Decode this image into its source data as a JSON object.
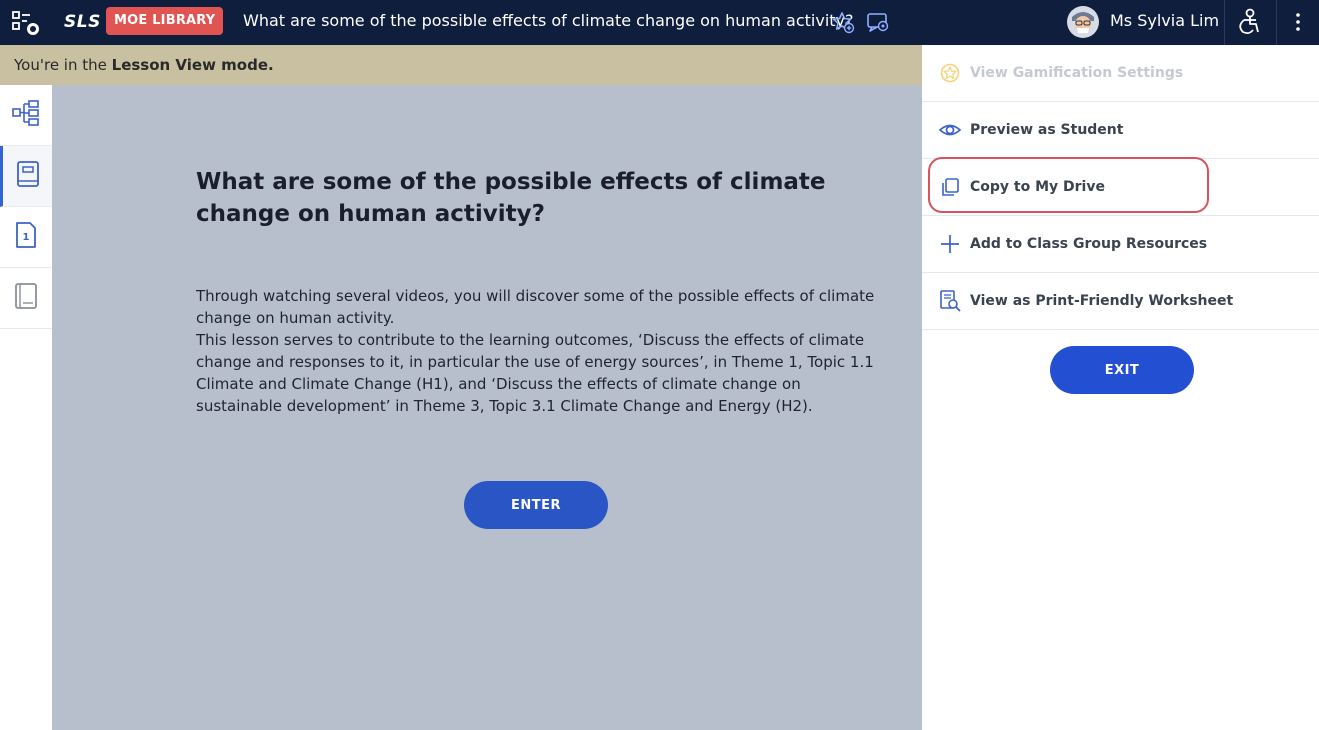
{
  "topbar": {
    "logo": "SLS",
    "badge": "MOE LIBRARY",
    "title": "What are some of the possible effects of climate change on human activity?",
    "user_name": "Ms Sylvia Lim",
    "icons": [
      "apps-icon",
      "add-favourite-icon",
      "monitor-icon",
      "avatar",
      "accessibility-icon",
      "more-vert-icon"
    ]
  },
  "banner": {
    "prefix": "You're in the ",
    "mode": "Lesson View mode."
  },
  "sidebar": {
    "items": [
      {
        "icon": "lesson-map-icon",
        "active": false
      },
      {
        "icon": "book-icon",
        "active": true
      },
      {
        "icon": "page-number-icon",
        "number": "1",
        "active": false
      },
      {
        "icon": "notebook-icon",
        "active": false
      }
    ]
  },
  "main": {
    "title": "What are some of the possible effects of climate change on human activity?",
    "paragraph1": "Through watching several videos, you will discover some of the possible effects of climate change on human activity.",
    "paragraph2": "This lesson serves to contribute to the learning outcomes, ‘Discuss the effects of climate change and responses to it, in particular the use of energy sources’, in Theme 1, Topic 1.1 Climate and Climate Change (H1), and ‘Discuss the effects of climate change on sustainable development’ in Theme 3, Topic 3.1 Climate Change and Energy (H2).",
    "enter_label": "ENTER"
  },
  "panel": {
    "items": [
      {
        "label": "View Gamification Settings",
        "icon": "gamification-icon",
        "disabled": true
      },
      {
        "label": "Preview as Student",
        "icon": "eye-icon",
        "disabled": false
      },
      {
        "label": "Copy to My Drive",
        "icon": "copy-icon",
        "disabled": false,
        "highlighted": true
      },
      {
        "label": "Add to Class Group Resources",
        "icon": "plus-icon",
        "disabled": false
      },
      {
        "label": "View as Print-Friendly Worksheet",
        "icon": "worksheet-search-icon",
        "disabled": false
      }
    ],
    "exit_label": "EXIT"
  },
  "colors": {
    "topbar": "#0f1e3d",
    "badge": "#e05452",
    "banner": "#c8c0a0",
    "main_bg": "#b8bfcc",
    "primary_button": "#2350d2",
    "highlight": "#d8545a",
    "icon_blue": "#3d63c9"
  }
}
